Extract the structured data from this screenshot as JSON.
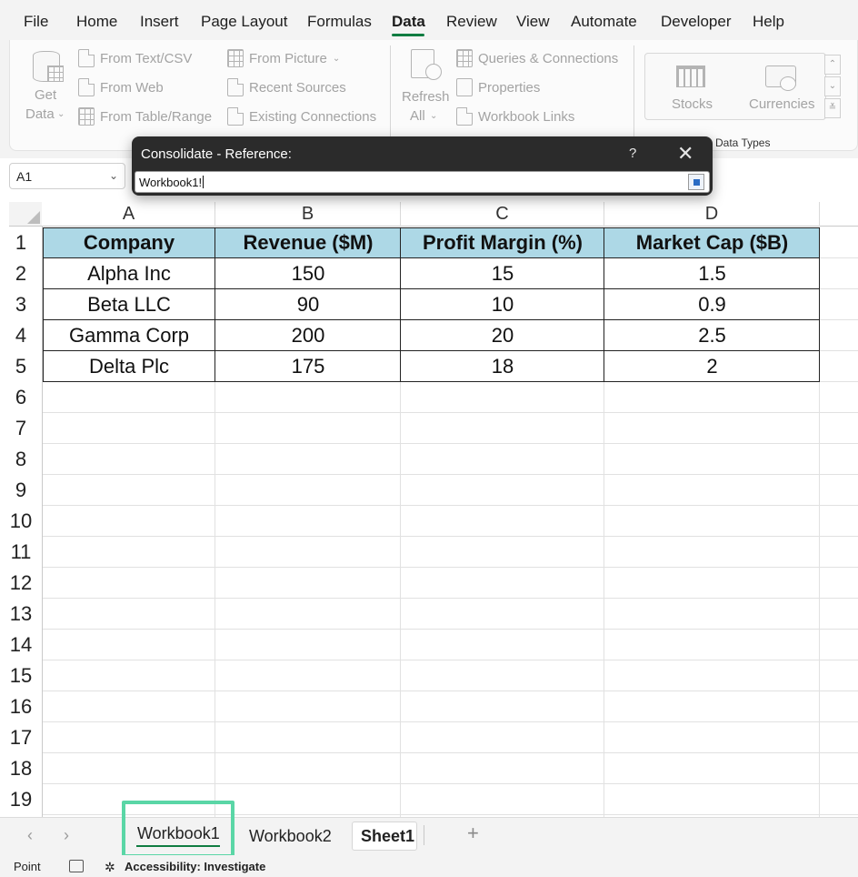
{
  "menu": {
    "items": [
      "File",
      "Home",
      "Insert",
      "Page Layout",
      "Formulas",
      "Data",
      "Review",
      "View",
      "Automate",
      "Developer",
      "Help"
    ],
    "active": "Data"
  },
  "ribbon": {
    "get_data_line1": "Get",
    "get_data_line2": "Data",
    "from_text_csv": "From Text/CSV",
    "from_web": "From Web",
    "from_table_range": "From Table/Range",
    "from_picture": "From Picture",
    "recent_sources": "Recent Sources",
    "existing_connections": "Existing Connections",
    "refresh_line1": "Refresh",
    "refresh_line2": "All",
    "queries_connections": "Queries & Connections",
    "properties": "Properties",
    "workbook_links": "Workbook Links",
    "stocks": "Stocks",
    "currencies": "Currencies",
    "data_types_label": "Data Types"
  },
  "namebox": {
    "value": "A1"
  },
  "dialog": {
    "title": "Consolidate - Reference:",
    "help": "?",
    "reference_value": "Workbook1!"
  },
  "columns": [
    "A",
    "B",
    "C",
    "D"
  ],
  "rows": [
    "1",
    "2",
    "3",
    "4",
    "5",
    "6",
    "7",
    "8",
    "9",
    "10",
    "11",
    "12",
    "13",
    "14",
    "15",
    "16",
    "17",
    "18",
    "19"
  ],
  "table": {
    "headers": [
      "Company",
      "Revenue ($M)",
      "Profit Margin (%)",
      "Market Cap ($B)"
    ],
    "rows": [
      [
        "Alpha Inc",
        "150",
        "15",
        "1.5"
      ],
      [
        "Beta LLC",
        "90",
        "10",
        "0.9"
      ],
      [
        "Gamma Corp",
        "200",
        "20",
        "2.5"
      ],
      [
        "Delta Plc",
        "175",
        "18",
        "2"
      ]
    ],
    "header_fill": "#add8e6"
  },
  "sheets": {
    "tabs": [
      "Workbook1",
      "Workbook2",
      "Sheet1"
    ],
    "selected": "Workbook1",
    "highlight_color": "#5ad6a6"
  },
  "status": {
    "mode": "Point",
    "accessibility": "Accessibility: Investigate"
  }
}
